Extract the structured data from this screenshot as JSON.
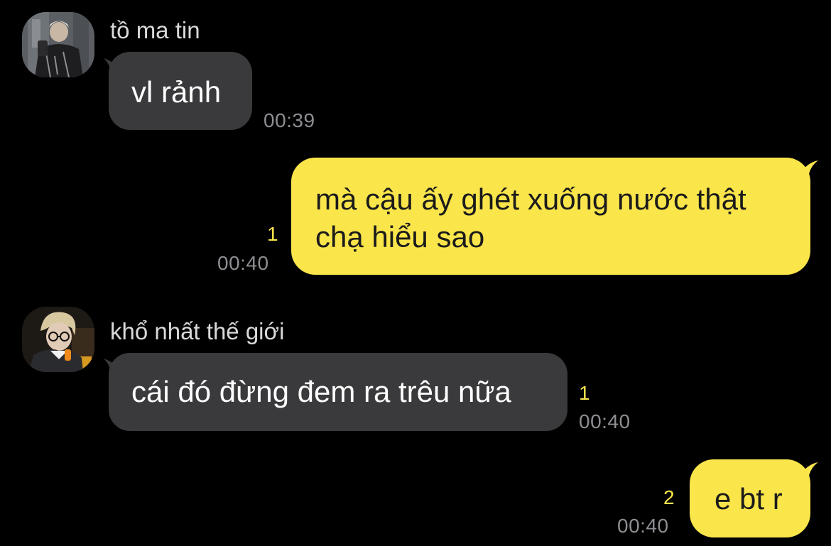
{
  "colors": {
    "background": "#000000",
    "incoming_bubble": "#3a3a3c",
    "outgoing_bubble": "#fae54b",
    "unread_count": "#fae54b",
    "timestamp": "#8e8e93"
  },
  "messages": [
    {
      "direction": "incoming",
      "sender": "tồ ma tin",
      "avatar_icon": "profile-photo-mirror-selfie",
      "text": "vl rảnh",
      "time": "00:39"
    },
    {
      "direction": "outgoing",
      "lines": [
        "mà cậu ấy ghét xuống nước thật",
        "chạ hiểu sao"
      ],
      "unread": "1",
      "time": "00:40"
    },
    {
      "direction": "incoming",
      "sender": "khổ nhất thế giới",
      "avatar_icon": "profile-photo-glasses",
      "text": "cái đó đừng đem ra trêu nữa",
      "unread": "1",
      "time": "00:40"
    },
    {
      "direction": "outgoing",
      "text": "e bt r",
      "unread": "2",
      "time": "00:40"
    }
  ]
}
